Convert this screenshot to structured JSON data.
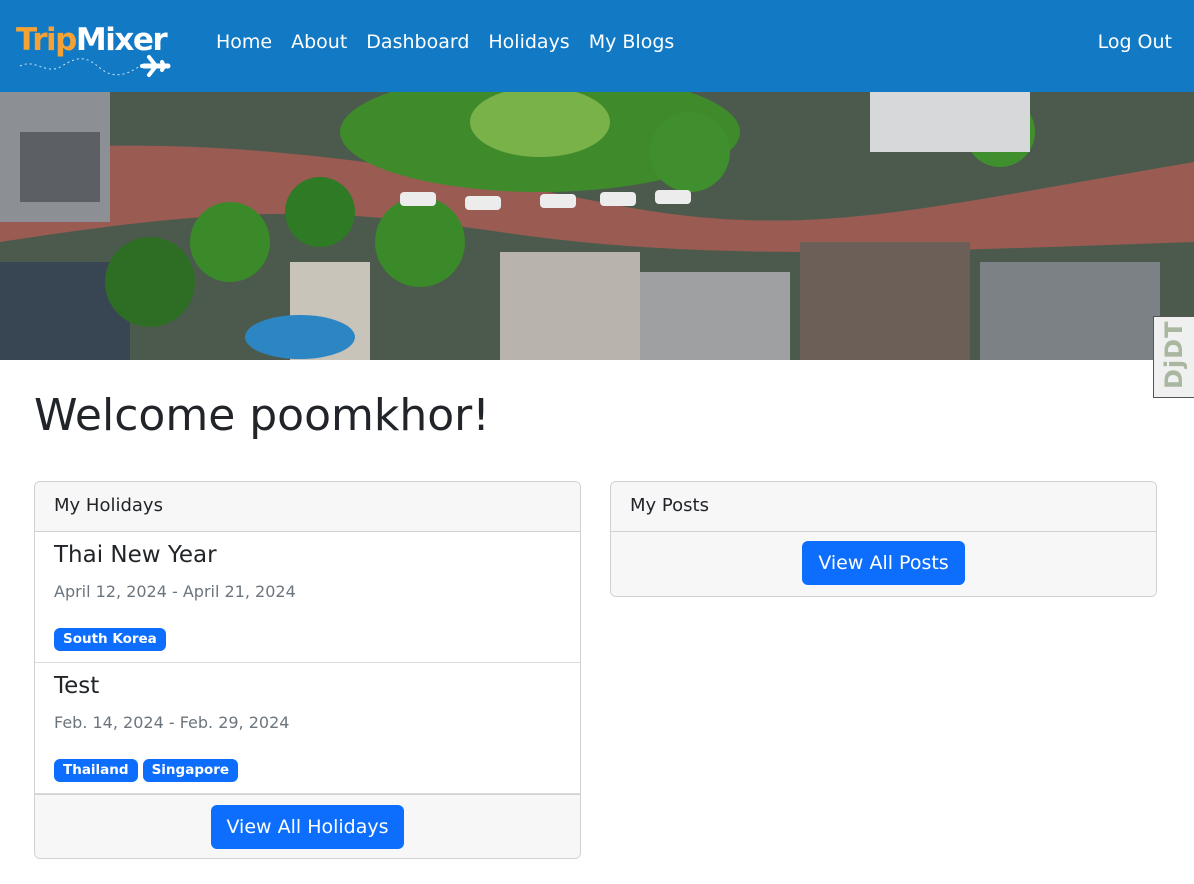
{
  "brand": {
    "part1": "Trip",
    "part2": "Mixer",
    "colors": {
      "trip": "#f4a236",
      "mixer": "#ffffff",
      "navbar": "#1279c5"
    },
    "icon": "airplane-icon"
  },
  "nav": {
    "links": [
      "Home",
      "About",
      "Dashboard",
      "Holidays",
      "My Blogs"
    ],
    "logout": "Log Out"
  },
  "hero": {
    "description_icon": "aerial-city-banner-image"
  },
  "side_tab": {
    "label": "DjDT"
  },
  "welcome": "Welcome poomkhor!",
  "holidays_card": {
    "title": "My Holidays",
    "items": [
      {
        "name": "Thai New Year",
        "dates": "April 12, 2024 - April 21, 2024",
        "countries": [
          "South Korea"
        ]
      },
      {
        "name": "Test",
        "dates": "Feb. 14, 2024 - Feb. 29, 2024",
        "countries": [
          "Thailand",
          "Singapore"
        ]
      }
    ],
    "button": "View All Holidays"
  },
  "posts_card": {
    "title": "My Posts",
    "button": "View All Posts"
  },
  "colors": {
    "primary_button": "#0d6efd",
    "muted_text": "#6c757d",
    "card_header_bg": "#f7f7f7"
  }
}
